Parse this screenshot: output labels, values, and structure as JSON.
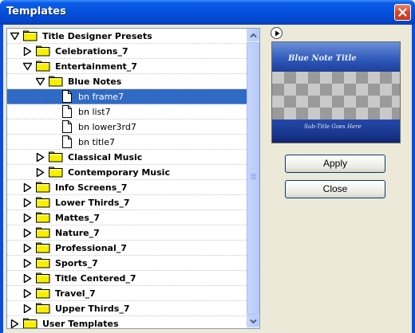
{
  "window": {
    "title": "Templates"
  },
  "tree": {
    "rows": [
      {
        "label": "Title Designer Presets",
        "type": "folder",
        "expander": "expanded",
        "depth": 0,
        "bold": true,
        "selected": false
      },
      {
        "label": "Celebrations_7",
        "type": "folder",
        "expander": "collapsed",
        "depth": 1,
        "bold": true,
        "selected": false
      },
      {
        "label": "Entertainment_7",
        "type": "folder",
        "expander": "expanded",
        "depth": 1,
        "bold": true,
        "selected": false
      },
      {
        "label": "Blue Notes",
        "type": "folder",
        "expander": "expanded",
        "depth": 2,
        "bold": true,
        "selected": false
      },
      {
        "label": "bn frame7",
        "type": "file",
        "expander": "none",
        "depth": 3,
        "bold": false,
        "selected": true
      },
      {
        "label": "bn list7",
        "type": "file",
        "expander": "none",
        "depth": 3,
        "bold": false,
        "selected": false
      },
      {
        "label": "bn lower3rd7",
        "type": "file",
        "expander": "none",
        "depth": 3,
        "bold": false,
        "selected": false
      },
      {
        "label": "bn title7",
        "type": "file",
        "expander": "none",
        "depth": 3,
        "bold": false,
        "selected": false
      },
      {
        "label": "Classical Music",
        "type": "folder",
        "expander": "collapsed",
        "depth": 2,
        "bold": true,
        "selected": false
      },
      {
        "label": "Contemporary Music",
        "type": "folder",
        "expander": "collapsed",
        "depth": 2,
        "bold": true,
        "selected": false
      },
      {
        "label": "Info Screens_7",
        "type": "folder",
        "expander": "collapsed",
        "depth": 1,
        "bold": true,
        "selected": false
      },
      {
        "label": "Lower Thirds_7",
        "type": "folder",
        "expander": "collapsed",
        "depth": 1,
        "bold": true,
        "selected": false
      },
      {
        "label": "Mattes_7",
        "type": "folder",
        "expander": "collapsed",
        "depth": 1,
        "bold": true,
        "selected": false
      },
      {
        "label": "Nature_7",
        "type": "folder",
        "expander": "collapsed",
        "depth": 1,
        "bold": true,
        "selected": false
      },
      {
        "label": "Professional_7",
        "type": "folder",
        "expander": "collapsed",
        "depth": 1,
        "bold": true,
        "selected": false
      },
      {
        "label": "Sports_7",
        "type": "folder",
        "expander": "collapsed",
        "depth": 1,
        "bold": true,
        "selected": false
      },
      {
        "label": "Title Centered_7",
        "type": "folder",
        "expander": "collapsed",
        "depth": 1,
        "bold": true,
        "selected": false
      },
      {
        "label": "Travel_7",
        "type": "folder",
        "expander": "collapsed",
        "depth": 1,
        "bold": true,
        "selected": false
      },
      {
        "label": "Upper Thirds_7",
        "type": "folder",
        "expander": "collapsed",
        "depth": 1,
        "bold": true,
        "selected": false
      },
      {
        "label": "User Templates",
        "type": "folder",
        "expander": "collapsed",
        "depth": 0,
        "bold": true,
        "selected": false
      }
    ]
  },
  "preview": {
    "title_text": "Blue Note Title",
    "subtitle_text": "Sub-Title Goes Here"
  },
  "buttons": {
    "apply": "Apply",
    "close": "Close"
  },
  "icons": {
    "close": "close-icon",
    "play": "play-icon",
    "folder": "folder-icon",
    "file": "document-icon",
    "expanded": "triangle-down-icon",
    "collapsed": "triangle-right-icon"
  },
  "colors": {
    "title_bar": "#0552dc",
    "selection": "#316ac5",
    "folder": "#f6f000",
    "dialog_bg": "#ece9d8",
    "close_button": "#d2462a"
  }
}
